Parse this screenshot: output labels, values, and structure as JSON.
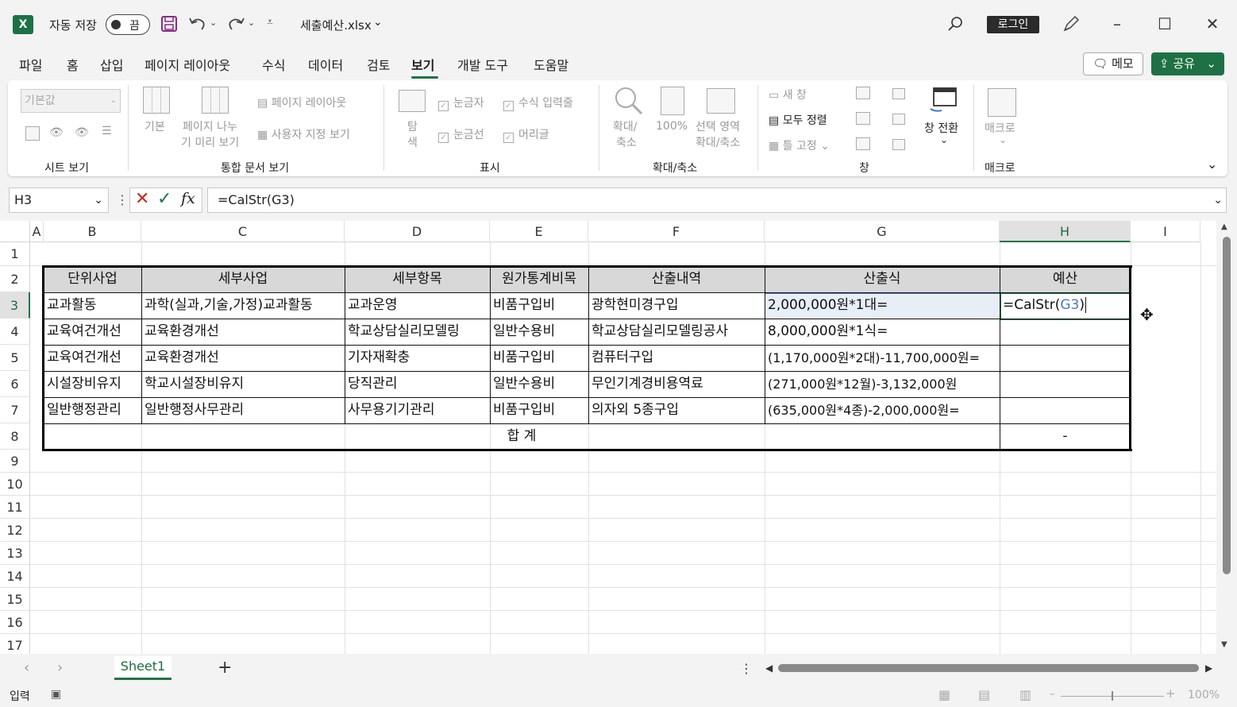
{
  "titlebar": {
    "app_icon": "X",
    "autosave_label": "자동 저장",
    "autosave_state": "끔",
    "filename": "세출예산.xlsx",
    "login": "로그인"
  },
  "menu": {
    "tabs": [
      "파일",
      "홈",
      "삽입",
      "페이지 레이아웃",
      "수식",
      "데이터",
      "검토",
      "보기",
      "개발 도구",
      "도움말"
    ],
    "active": "보기",
    "memo": "메모",
    "share": "공유"
  },
  "ribbon": {
    "sheet_view": {
      "combo": "기본값",
      "group": "시트 보기"
    },
    "workbook_views": {
      "normal": "기본",
      "page_break_1": "페이지 나누",
      "page_break_2": "기 미리 보기",
      "page_layout": "페이지 레이아웃",
      "custom": "사용자 지정 보기",
      "group": "통합 문서 보기"
    },
    "show": {
      "navigation_1": "탐",
      "navigation_2": "색",
      "ruler": "눈금자",
      "formula_bar": "수식 입력줄",
      "gridlines": "눈금선",
      "headings": "머리글",
      "group": "표시"
    },
    "zoom": {
      "zoom_1": "확대/",
      "zoom_2": "축소",
      "hundred": "100%",
      "selection_1": "선택 영역",
      "selection_2": "확대/축소",
      "group": "확대/축소"
    },
    "window": {
      "new_window": "새 창",
      "arrange_all": "모두 정렬",
      "freeze": "틀 고정",
      "switch": "창 전환",
      "group": "창"
    },
    "macros": {
      "macros": "매크로",
      "group": "매크로"
    }
  },
  "formula_bar": {
    "name_box": "H3",
    "formula": "=CalStr(G3)"
  },
  "grid": {
    "columns": [
      "A",
      "B",
      "C",
      "D",
      "E",
      "F",
      "G",
      "H",
      "I"
    ],
    "rows": [
      "1",
      "2",
      "3",
      "4",
      "5",
      "6",
      "7",
      "8",
      "9",
      "10",
      "11",
      "12",
      "13",
      "14",
      "15",
      "16",
      "17"
    ],
    "selected_col": "H",
    "selected_row": "3"
  },
  "table": {
    "headers": [
      "단위사업",
      "세부사업",
      "세부항목",
      "원가통계비목",
      "산출내역",
      "산출식",
      "예산"
    ],
    "rows": [
      [
        "교과활동",
        "과학(실과,기술,가정)교과활동",
        "교과운영",
        "비품구입비",
        "광학현미경구입",
        "2,000,000원*1대=",
        "=CalStr(G3)"
      ],
      [
        "교육여건개선",
        "교육환경개선",
        "학교상담실리모델링",
        "일반수용비",
        "학교상담실리모델링공사",
        "8,000,000원*1식=",
        ""
      ],
      [
        "교육여건개선",
        "교육환경개선",
        "기자재확충",
        "비품구입비",
        "컴퓨터구입",
        "(1,170,000원*2대)-11,700,000원=",
        ""
      ],
      [
        "시설장비유지",
        "학교시설장비유지",
        "당직관리",
        "일반수용비",
        "무인기계경비용역료",
        "(271,000원*12월)-3,132,000원",
        ""
      ],
      [
        "일반행정관리",
        "일반행정사무관리",
        "사무용기기관리",
        "비품구입비",
        "의자외 5종구입",
        "(635,000원*4종)-2,000,000원=",
        ""
      ]
    ],
    "total_label": "합 계",
    "total_value": "-"
  },
  "h3_edit": {
    "prefix": "=CalStr(",
    "ref": "G3",
    "suffix": ")"
  },
  "sheets": {
    "active": "Sheet1",
    "add": "+"
  },
  "status": {
    "mode": "입력",
    "zoom": "100%"
  },
  "colors": {
    "excel_green": "#217346",
    "ref_blue": "#4a79c9",
    "header_fill": "#d8d8d8"
  }
}
